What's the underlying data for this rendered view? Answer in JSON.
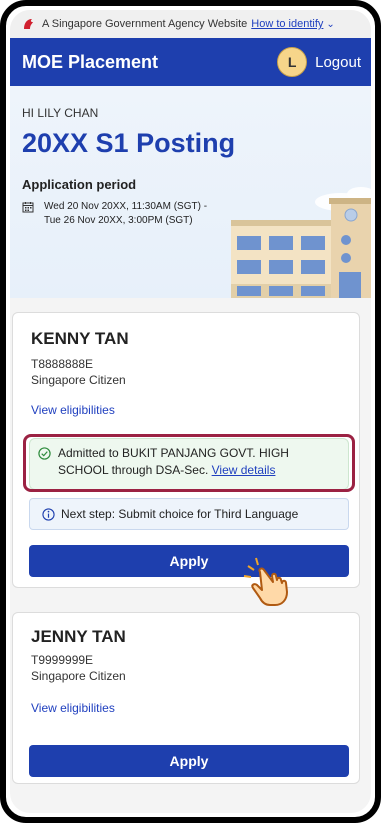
{
  "gov_bar": {
    "text": "A Singapore Government Agency Website",
    "link": "How to identify"
  },
  "header": {
    "title": "MOE Placement",
    "avatar_initial": "L",
    "logout_label": "Logout"
  },
  "hero": {
    "greeting": "HI LILY CHAN",
    "title": "20XX S1 Posting",
    "period_label": "Application period",
    "period_line1": "Wed 20 Nov 20XX, 11:30AM (SGT) -",
    "period_line2": "Tue 26 Nov 20XX, 3:00PM (SGT)"
  },
  "students": [
    {
      "name": "KENNY TAN",
      "id": "T8888888E",
      "citizenship": "Singapore Citizen",
      "eligibility_link": "View eligibilities",
      "admission_text": "Admitted to BUKIT PANJANG GOVT. HIGH SCHOOL through DSA-Sec.",
      "admission_link": "View details",
      "next_step": "Next step: Submit choice for Third Language",
      "apply_label": "Apply"
    },
    {
      "name": "JENNY TAN",
      "id": "T9999999E",
      "citizenship": "Singapore Citizen",
      "eligibility_link": "View eligibilities",
      "apply_label": "Apply"
    }
  ],
  "icons": {
    "gov": "lion-head-icon",
    "calendar": "calendar-icon",
    "admitted": "check-circle-icon",
    "next_step": "info-icon",
    "pointer": "hand-pointer-icon"
  },
  "colors": {
    "primary": "#1e3fae",
    "highlight": "#9b2243",
    "success_bg": "#eef8ef"
  }
}
